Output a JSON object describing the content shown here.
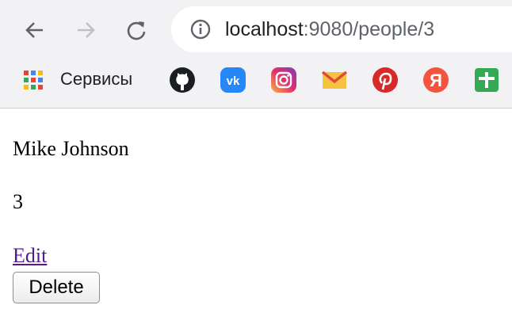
{
  "browser": {
    "url_host": "localhost",
    "url_rest": ":9080/people/3",
    "bookmarks_apps_label": "Сервисы"
  },
  "bookmarks": [
    "github",
    "vk",
    "instagram",
    "gmail",
    "pinterest",
    "yandex",
    "google-sheets"
  ],
  "colors": {
    "chrome_bg": "#f2f2f4",
    "link_visited": "#551a8b"
  },
  "person": {
    "name": "Mike Johnson",
    "id": "3",
    "edit_label": "Edit",
    "delete_label": "Delete"
  }
}
